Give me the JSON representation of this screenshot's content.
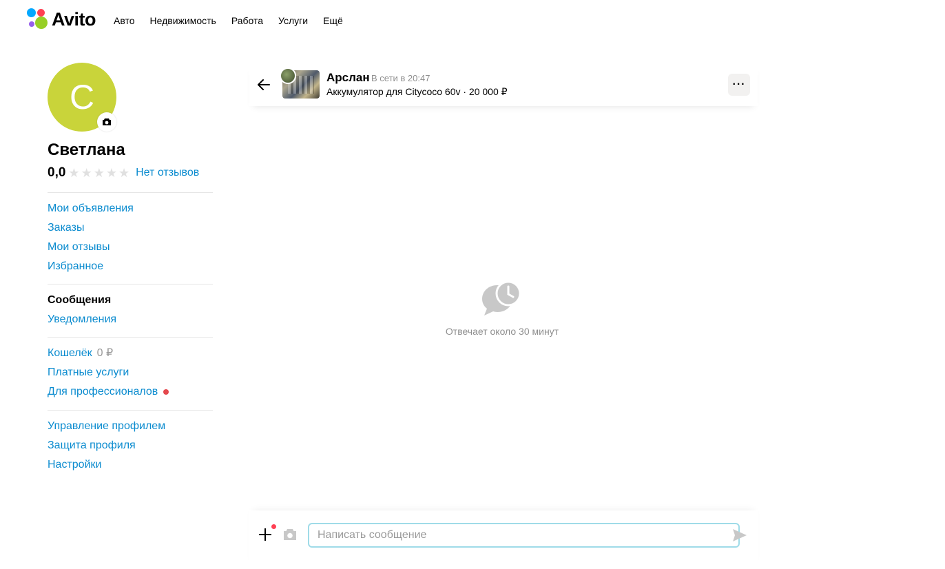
{
  "header": {
    "logo_text": "Avito",
    "nav": [
      "Авто",
      "Недвижимость",
      "Работа",
      "Услуги",
      "Ещё"
    ]
  },
  "profile": {
    "avatar_letter": "С",
    "name": "Светлана",
    "rating": "0,0",
    "stars_filled": 0,
    "stars_total": 5,
    "reviews_link": "Нет отзывов"
  },
  "menu": {
    "group1": [
      "Мои объявления",
      "Заказы",
      "Мои отзывы",
      "Избранное"
    ],
    "messages": "Сообщения",
    "notifications": "Уведомления",
    "wallet": "Кошелёк",
    "wallet_amount": "0 ₽",
    "paid_services": "Платные услуги",
    "for_pros": "Для профессионалов",
    "group4": [
      "Управление профилем",
      "Защита профиля",
      "Настройки"
    ]
  },
  "chat": {
    "seller_name": "Арслан",
    "seller_status": "В сети в 20:47",
    "item_line": "Аккумулятор для Citycoco 60v · 20 000 ₽",
    "more_label": "···",
    "empty_text": "Отвечает около 30 минут"
  },
  "composer": {
    "placeholder": "Написать сообщение",
    "value": ""
  },
  "colors": {
    "link": "#0a8bcf",
    "avatar_bg": "#c9d43a",
    "input_border": "#9fdbe8",
    "badge_red": "#e4484d"
  },
  "icons": [
    "camera-icon",
    "arrow-left-icon",
    "more-icon",
    "chat-clock-icon",
    "plus-icon",
    "camera-icon",
    "send-icon"
  ]
}
